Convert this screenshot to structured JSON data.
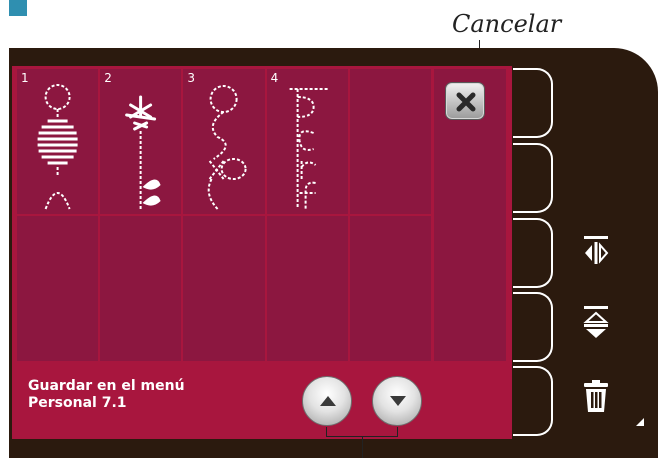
{
  "callout": {
    "text": "Cancelar"
  },
  "grid": {
    "cells": [
      {
        "number": "1",
        "stitch": "stitch-1-icon"
      },
      {
        "number": "2",
        "stitch": "stitch-2-icon"
      },
      {
        "number": "3",
        "stitch": "stitch-3-icon"
      },
      {
        "number": "4",
        "stitch": "stitch-4-icon"
      },
      {
        "number": "",
        "stitch": ""
      },
      {
        "number": "",
        "stitch": ""
      },
      {
        "number": "",
        "stitch": ""
      },
      {
        "number": "",
        "stitch": ""
      },
      {
        "number": "",
        "stitch": ""
      },
      {
        "number": "",
        "stitch": ""
      }
    ]
  },
  "status": {
    "line1": "Guardar en el menú",
    "line2": "Personal 7.1"
  },
  "icons": {
    "cancel": "close-icon",
    "scroll_up": "arrow-up-icon",
    "scroll_down": "arrow-down-icon",
    "mirror_side": "mirror-side-to-side-icon",
    "mirror_end": "mirror-end-to-end-icon",
    "delete": "trash-icon"
  },
  "colors": {
    "screen": "#a8163e",
    "cell": "#8c1740",
    "device": "#2b1a0e",
    "tab": "#2f8fb0"
  }
}
